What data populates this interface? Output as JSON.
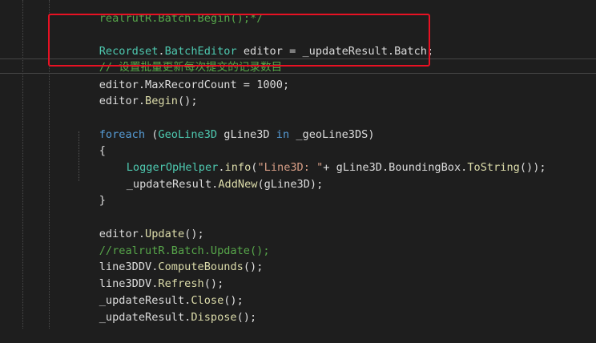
{
  "lines": {
    "l0": {
      "a": "realrutR.",
      "b": "Batch",
      "c": ".",
      "d": "Begin",
      "e": "();*/"
    },
    "l1": {
      "type1": "Recordset",
      "dot": ".",
      "type2": "BatchEditor",
      "rest": " editor = _updateResult.",
      "prop": "Batch",
      "end": ";"
    },
    "l2": {
      "comment": "// 设置批量更新每次提交的记录数目"
    },
    "l3": {
      "a": "editor.",
      "prop": "MaxRecordCount",
      "b": " = ",
      "num": "1000",
      "c": ";"
    },
    "l4": {
      "a": "editor.",
      "m": "Begin",
      "b": "();"
    },
    "l5": {
      "kw": "foreach",
      "a": " (",
      "type": "GeoLine3D",
      "b": " gLine3D ",
      "kw2": "in",
      "c": " _geoLine3DS)"
    },
    "l6": {
      "a": "{"
    },
    "l7": {
      "type": "LoggerOpHelper",
      "a": ".",
      "m": "info",
      "b": "(",
      "str": "\"Line3D: \"",
      "c": "+ gLine3D.",
      "prop": "BoundingBox",
      "d": ".",
      "m2": "ToString",
      "e": "());"
    },
    "l8": {
      "a": "_updateResult.",
      "m": "AddNew",
      "b": "(gLine3D);"
    },
    "l9": {
      "a": "}"
    },
    "l10": {
      "a": "editor.",
      "m": "Update",
      "b": "();"
    },
    "l11": {
      "comment": "//realrutR.Batch.Update();"
    },
    "l12": {
      "a": "line3DDV.",
      "m": "ComputeBounds",
      "b": "();"
    },
    "l13": {
      "a": "line3DDV.",
      "m": "Refresh",
      "b": "();"
    },
    "l14": {
      "a": "_updateResult.",
      "m": "Close",
      "b": "();"
    },
    "l15": {
      "a": "_updateResult.",
      "m": "Dispose",
      "b": "();"
    }
  },
  "colors": {
    "background": "#1e1e1e",
    "highlight_box": "#e81123",
    "type": "#4ec9b0",
    "keyword": "#569cd6",
    "comment": "#57a64a",
    "string": "#d69d85",
    "method": "#dcdcaa",
    "text": "#dcdcdc"
  }
}
